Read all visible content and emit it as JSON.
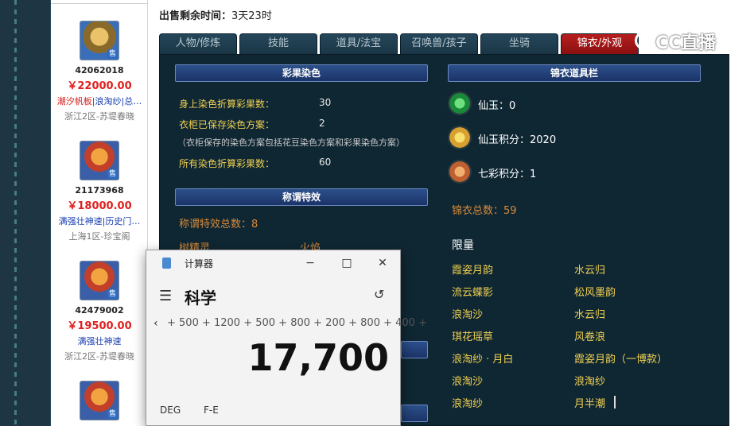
{
  "sale_time": {
    "label": "出售剩余时间：",
    "value": "3天23时"
  },
  "tabs": [
    "人物/修炼",
    "技能",
    "道具/法宝",
    "召唤兽/孩子",
    "坐骑",
    "锦衣/外观"
  ],
  "watermark": "CC直播",
  "listings": [
    {
      "id": "42062018",
      "price": "￥22000.00",
      "tags_red": "潮汐帆板",
      "tags": "|浪淘纱|总…",
      "server": "浙江2区-苏堤春晓",
      "badge": "售"
    },
    {
      "id": "21173968",
      "price": "￥18000.00",
      "tags_red": "",
      "tags": "满强壮神速|历史门…",
      "server": "上海1区-珍宝阁",
      "badge": "售"
    },
    {
      "id": "42479002",
      "price": "￥19500.00",
      "tags_red": "",
      "tags": "满强壮神速",
      "server": "浙江2区-苏堤春晓",
      "badge": "售"
    },
    {
      "id": "",
      "price": "",
      "tags_red": "",
      "tags": "",
      "server": "",
      "badge": "售"
    }
  ],
  "dye_section": {
    "title": "彩果染色",
    "rows": [
      {
        "label": "身上染色折算彩果数：",
        "value": "30"
      },
      {
        "label": "衣柜已保存染色方案：",
        "value": "2"
      }
    ],
    "note": "（衣柜保存的染色方案包括花豆染色方案和彩果染色方案）",
    "total": {
      "label": "所有染色折算彩果数：",
      "value": "60"
    }
  },
  "title_section": {
    "title": "称谓特效",
    "count_label": "称谓特效总数：8",
    "partial_items": [
      "树精灵",
      "火焰"
    ]
  },
  "wardrobe_section": {
    "title": "锦衣道具栏",
    "items": [
      {
        "icon": "jade-icon",
        "text": "仙玉：0"
      },
      {
        "icon": "points-ticket-icon",
        "text": "仙玉积分：2020"
      },
      {
        "icon": "rainbow-orb-icon",
        "text": "七彩积分：1"
      }
    ],
    "total": "锦衣总数：59",
    "limited_title": "限量",
    "limited_items": [
      [
        "霞姿月韵",
        "水云归"
      ],
      [
        "流云蝶影",
        "松风墨韵"
      ],
      [
        "浪淘沙",
        "水云归"
      ],
      [
        "琪花瑶草",
        "风卷浪"
      ],
      [
        "浪淘纱 · 月白",
        "霞姿月韵（一博款）"
      ],
      [
        "浪淘沙",
        "浪淘纱"
      ],
      [
        "浪淘纱",
        "月半潮"
      ]
    ]
  },
  "calculator": {
    "app_title": "计算器",
    "mode": "科学",
    "expression": "+ 500 + 1200 + 500 + 800 + 200 + 800 + 400 +",
    "result": "17,700",
    "angle_unit": "DEG",
    "notation": "F-E"
  },
  "colors": {
    "active_tab": "#b81e1e",
    "panel_bg": "#0f2733",
    "label_yellow": "#f0d050",
    "price_red": "#e02020"
  }
}
